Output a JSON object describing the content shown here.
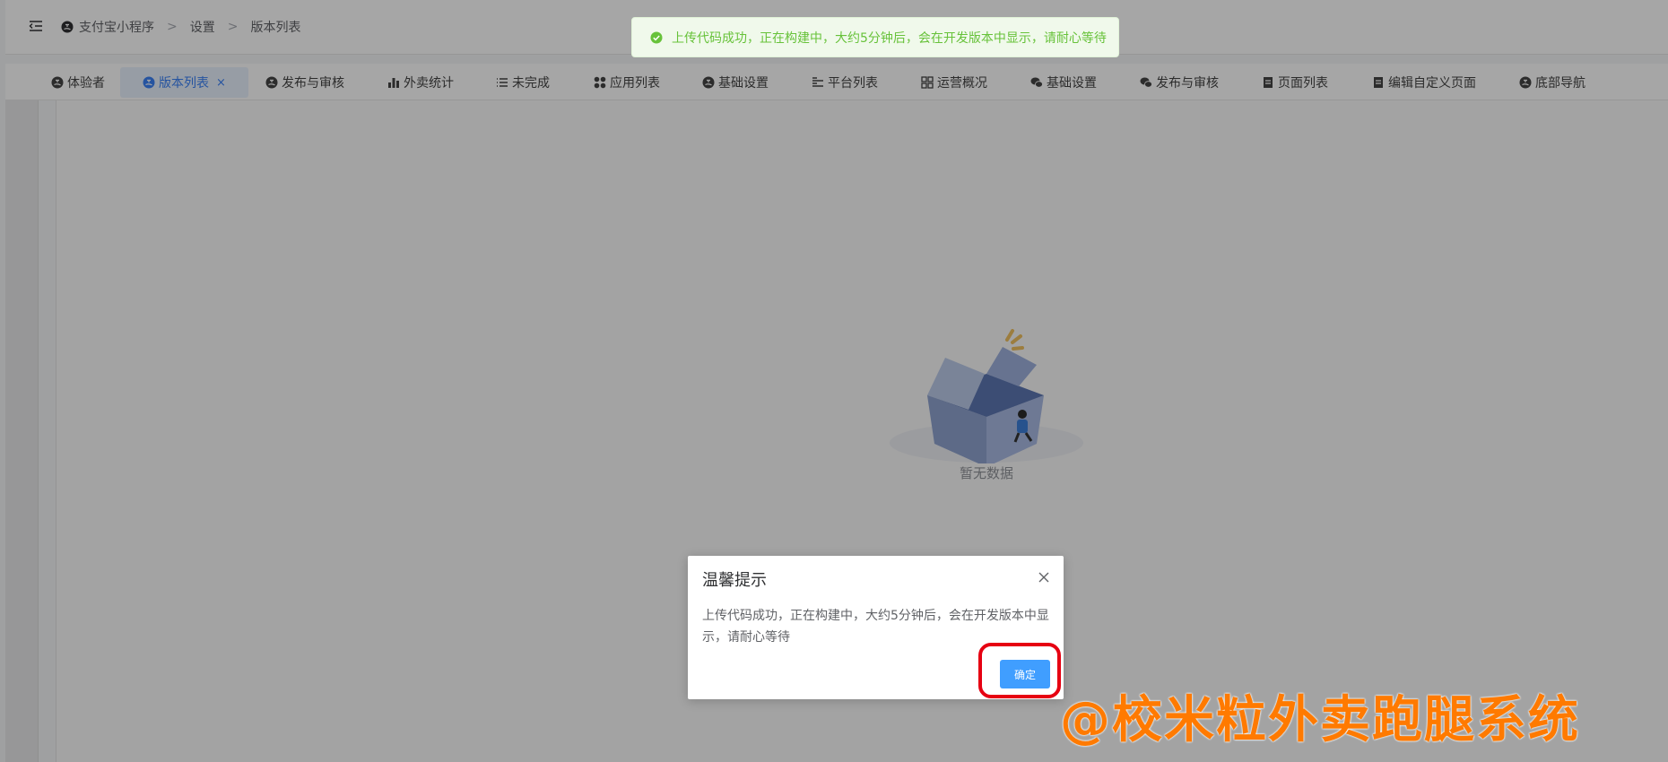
{
  "breadcrumb": [
    "支付宝小程序",
    "设置",
    "版本列表"
  ],
  "breadcrumb_sep": ">",
  "toast": {
    "message": "上传代码成功，正在构建中，大约5分钟后，会在开发版本中显示，请耐心等待",
    "icon": "check-circle-icon",
    "color": "#67c23a"
  },
  "tabs": [
    {
      "label": "体验者",
      "icon": "alipay-icon",
      "active": false
    },
    {
      "label": "版本列表",
      "icon": "alipay-icon",
      "active": true,
      "closable": true
    },
    {
      "label": "发布与审核",
      "icon": "alipay-icon",
      "active": false
    },
    {
      "label": "外卖统计",
      "icon": "bar-chart-icon",
      "active": false
    },
    {
      "label": "未完成",
      "icon": "list-icon",
      "active": false
    },
    {
      "label": "应用列表",
      "icon": "apps-icon",
      "active": false
    },
    {
      "label": "基础设置",
      "icon": "alipay-icon",
      "active": false
    },
    {
      "label": "平台列表",
      "icon": "list-detail-icon",
      "active": false
    },
    {
      "label": "运营概况",
      "icon": "grid-icon",
      "active": false
    },
    {
      "label": "基础设置",
      "icon": "wechat-icon",
      "active": false
    },
    {
      "label": "发布与审核",
      "icon": "wechat-icon",
      "active": false
    },
    {
      "label": "页面列表",
      "icon": "page-icon",
      "active": false
    },
    {
      "label": "编辑自定义页面",
      "icon": "page-icon",
      "active": false
    },
    {
      "label": "底部导航",
      "icon": "alipay-icon",
      "active": false
    }
  ],
  "tab_close_glyph": "×",
  "empty": {
    "text": "暂无数据"
  },
  "dialog": {
    "title": "温馨提示",
    "message": "上传代码成功，正在构建中，大约5分钟后，会在开发版本中显示，请耐心等待",
    "ok_label": "确定"
  },
  "watermark": "@校米粒外卖跑腿系统",
  "colors": {
    "primary": "#409eff",
    "success": "#67c23a",
    "highlight": "#e60012",
    "watermark": "#ff7a00"
  }
}
